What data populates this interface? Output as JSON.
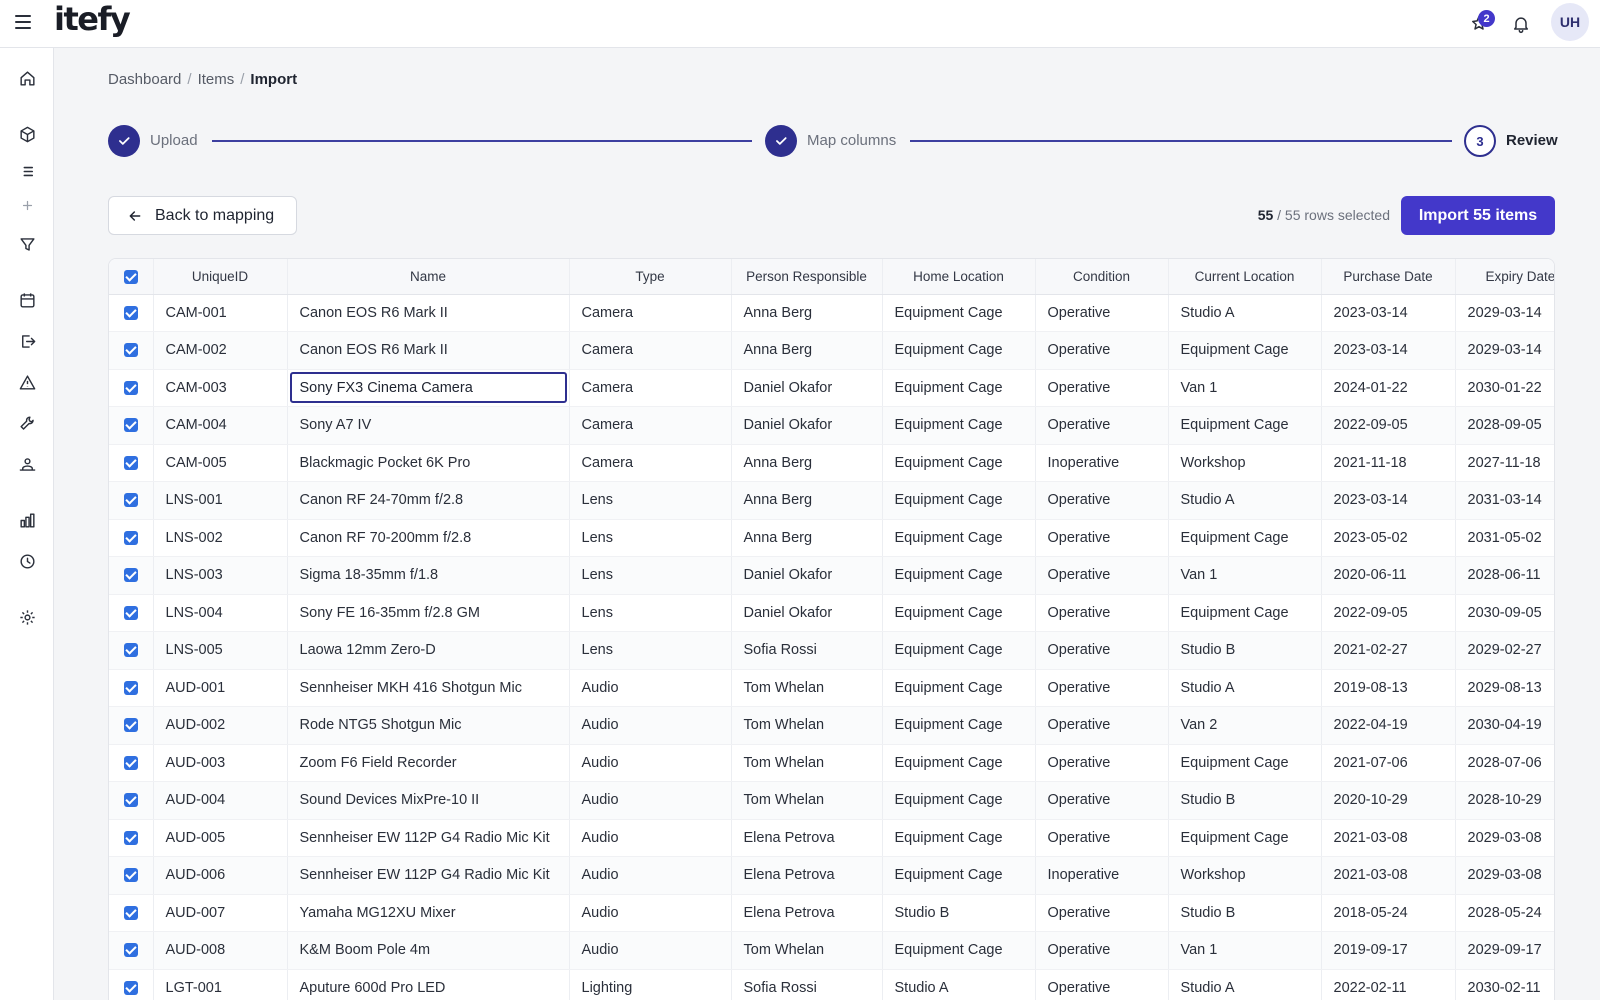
{
  "app": {
    "logo": "itefy"
  },
  "header": {
    "notification_badge": "2",
    "avatar_initials": "UH"
  },
  "breadcrumb": {
    "items": [
      "Dashboard",
      "Items"
    ],
    "current": "Import",
    "separator": "/"
  },
  "stepper": {
    "steps": [
      {
        "label": "Upload",
        "state": "done"
      },
      {
        "label": "Map columns",
        "state": "done"
      },
      {
        "label": "Review",
        "state": "current",
        "number": "3"
      }
    ]
  },
  "actions": {
    "back_label": "Back to mapping",
    "selected_count": "55",
    "selected_rest": "/ 55 rows selected",
    "import_label": "Import 55 items"
  },
  "table": {
    "columns": [
      "UniqueID",
      "Name",
      "Type",
      "Person Responsible",
      "Home Location",
      "Condition",
      "Current Location",
      "Purchase Date",
      "Expiry Date"
    ],
    "rows": [
      [
        "CAM-001",
        "Canon EOS R6 Mark II",
        "Camera",
        "Anna Berg",
        "Equipment Cage",
        "Operative",
        "Studio A",
        "2023-03-14",
        "2029-03-14"
      ],
      [
        "CAM-002",
        "Canon EOS R6 Mark II",
        "Camera",
        "Anna Berg",
        "Equipment Cage",
        "Operative",
        "Equipment Cage",
        "2023-03-14",
        "2029-03-14"
      ],
      [
        "CAM-003",
        "Sony FX3 Cinema Camera",
        "Camera",
        "Daniel Okafor",
        "Equipment Cage",
        "Operative",
        "Van 1",
        "2024-01-22",
        "2030-01-22"
      ],
      [
        "CAM-004",
        "Sony A7 IV",
        "Camera",
        "Daniel Okafor",
        "Equipment Cage",
        "Operative",
        "Equipment Cage",
        "2022-09-05",
        "2028-09-05"
      ],
      [
        "CAM-005",
        "Blackmagic Pocket 6K Pro",
        "Camera",
        "Anna Berg",
        "Equipment Cage",
        "Inoperative",
        "Workshop",
        "2021-11-18",
        "2027-11-18"
      ],
      [
        "LNS-001",
        "Canon RF 24-70mm f/2.8",
        "Lens",
        "Anna Berg",
        "Equipment Cage",
        "Operative",
        "Studio A",
        "2023-03-14",
        "2031-03-14"
      ],
      [
        "LNS-002",
        "Canon RF 70-200mm f/2.8",
        "Lens",
        "Anna Berg",
        "Equipment Cage",
        "Operative",
        "Equipment Cage",
        "2023-05-02",
        "2031-05-02"
      ],
      [
        "LNS-003",
        "Sigma 18-35mm f/1.8",
        "Lens",
        "Daniel Okafor",
        "Equipment Cage",
        "Operative",
        "Van 1",
        "2020-06-11",
        "2028-06-11"
      ],
      [
        "LNS-004",
        "Sony FE 16-35mm f/2.8 GM",
        "Lens",
        "Daniel Okafor",
        "Equipment Cage",
        "Operative",
        "Equipment Cage",
        "2022-09-05",
        "2030-09-05"
      ],
      [
        "LNS-005",
        "Laowa 12mm Zero-D",
        "Lens",
        "Sofia Rossi",
        "Equipment Cage",
        "Operative",
        "Studio B",
        "2021-02-27",
        "2029-02-27"
      ],
      [
        "AUD-001",
        "Sennheiser MKH 416 Shotgun Mic",
        "Audio",
        "Tom Whelan",
        "Equipment Cage",
        "Operative",
        "Studio A",
        "2019-08-13",
        "2029-08-13"
      ],
      [
        "AUD-002",
        "Rode NTG5 Shotgun Mic",
        "Audio",
        "Tom Whelan",
        "Equipment Cage",
        "Operative",
        "Van 2",
        "2022-04-19",
        "2030-04-19"
      ],
      [
        "AUD-003",
        "Zoom F6 Field Recorder",
        "Audio",
        "Tom Whelan",
        "Equipment Cage",
        "Operative",
        "Equipment Cage",
        "2021-07-06",
        "2028-07-06"
      ],
      [
        "AUD-004",
        "Sound Devices MixPre-10 II",
        "Audio",
        "Tom Whelan",
        "Equipment Cage",
        "Operative",
        "Studio B",
        "2020-10-29",
        "2028-10-29"
      ],
      [
        "AUD-005",
        "Sennheiser EW 112P G4 Radio Mic Kit",
        "Audio",
        "Elena Petrova",
        "Equipment Cage",
        "Operative",
        "Equipment Cage",
        "2021-03-08",
        "2029-03-08"
      ],
      [
        "AUD-006",
        "Sennheiser EW 112P G4 Radio Mic Kit",
        "Audio",
        "Elena Petrova",
        "Equipment Cage",
        "Inoperative",
        "Workshop",
        "2021-03-08",
        "2029-03-08"
      ],
      [
        "AUD-007",
        "Yamaha MG12XU Mixer",
        "Audio",
        "Elena Petrova",
        "Studio B",
        "Operative",
        "Studio B",
        "2018-05-24",
        "2028-05-24"
      ],
      [
        "AUD-008",
        "K&M Boom Pole 4m",
        "Audio",
        "Tom Whelan",
        "Equipment Cage",
        "Operative",
        "Van 1",
        "2019-09-17",
        "2029-09-17"
      ],
      [
        "LGT-001",
        "Aputure 600d Pro LED",
        "Lighting",
        "Sofia Rossi",
        "Studio A",
        "Operative",
        "Studio A",
        "2022-02-11",
        "2030-02-11"
      ]
    ],
    "editing_cell": {
      "row": 2,
      "col": 1
    }
  }
}
